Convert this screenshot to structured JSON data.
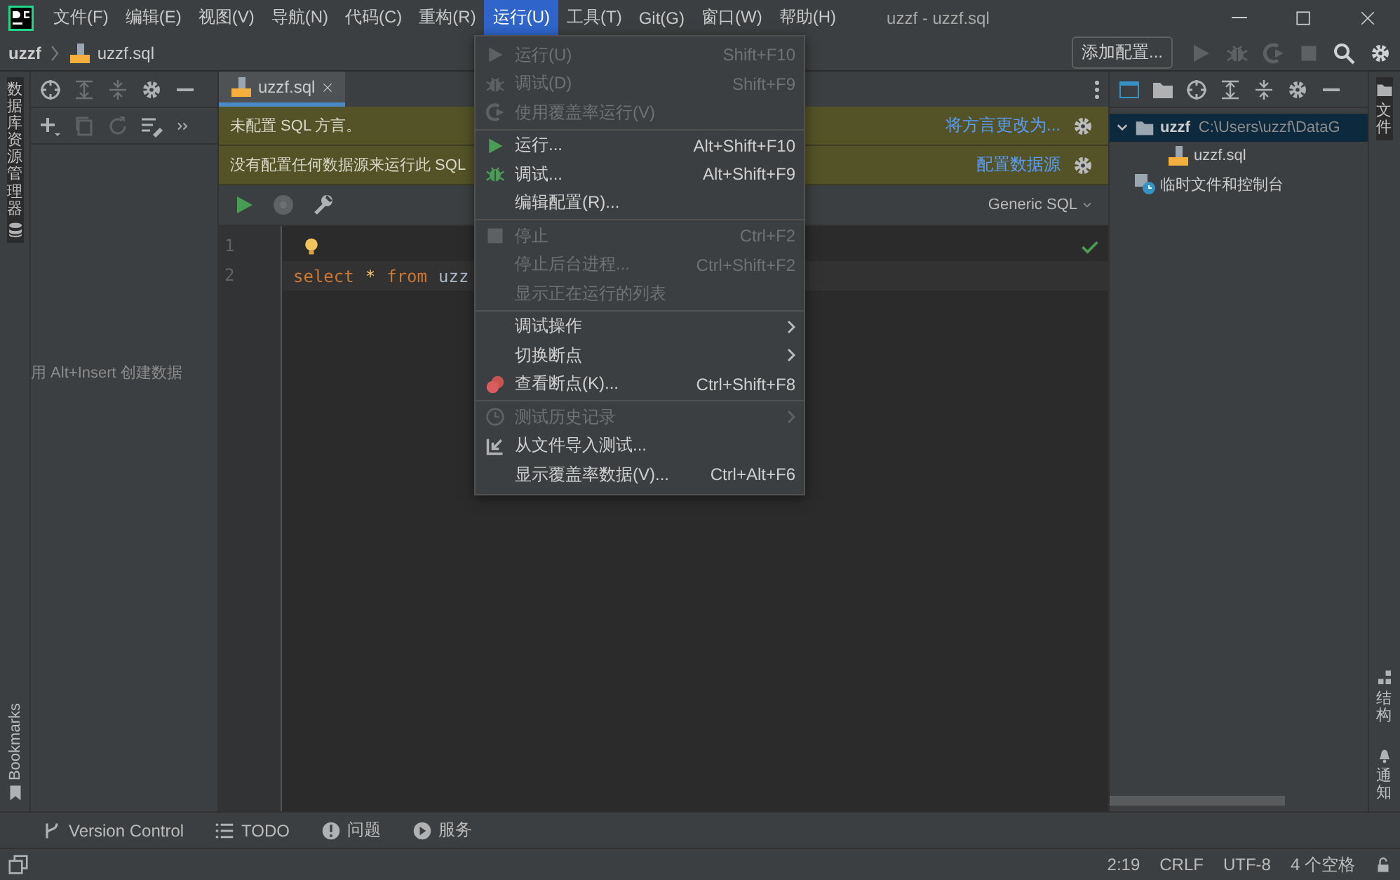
{
  "title_bar": {
    "menus": [
      {
        "label": "文件(F)",
        "selected": false
      },
      {
        "label": "编辑(E)",
        "selected": false
      },
      {
        "label": "视图(V)",
        "selected": false
      },
      {
        "label": "导航(N)",
        "selected": false
      },
      {
        "label": "代码(C)",
        "selected": false
      },
      {
        "label": "重构(R)",
        "selected": false
      },
      {
        "label": "运行(U)",
        "selected": true
      },
      {
        "label": "工具(T)",
        "selected": false
      },
      {
        "label": "Git(G)",
        "selected": false
      },
      {
        "label": "窗口(W)",
        "selected": false
      },
      {
        "label": "帮助(H)",
        "selected": false
      }
    ],
    "title": "uzzf - uzzf.sql"
  },
  "nav_bar": {
    "breadcrumb": [
      "uzzf",
      "uzzf.sql"
    ],
    "config_button": "添加配置..."
  },
  "left_stripe": {
    "top": "数据库资源管理器",
    "bottom": "Bookmarks"
  },
  "db_explorer": {
    "hint": "用 Alt+Insert 创建数据"
  },
  "editor": {
    "tab": {
      "label": "uzzf.sql",
      "selected": true
    },
    "banners": [
      {
        "text": "未配置 SQL 方言。",
        "action": "将方言更改为..."
      },
      {
        "text": "没有配置任何数据源来运行此 SQL",
        "action": "配置数据源"
      }
    ],
    "dialect": "Generic SQL",
    "lines": [
      {
        "number": "1"
      },
      {
        "number": "2",
        "tokens": [
          {
            "kind": "keyword",
            "text": "select"
          },
          {
            "kind": "operator",
            "text": "*"
          },
          {
            "kind": "keyword",
            "text": "from"
          },
          {
            "kind": "identifier",
            "text": "uzz"
          }
        ]
      }
    ]
  },
  "project": {
    "tree": [
      {
        "label": "uzzf",
        "path": "C:\\Users\\uzzf\\DataG",
        "expanded": true,
        "selected": true,
        "children": [
          {
            "label": "uzzf.sql",
            "selected": false
          }
        ]
      },
      {
        "label": "临时文件和控制台",
        "selected": false
      }
    ]
  },
  "right_stripe": {
    "top": "文件",
    "bottom": [
      "结构",
      "通知"
    ]
  },
  "tool_windows": [
    "Version Control",
    "TODO",
    "问题",
    "服务"
  ],
  "status_bar": [
    "2:19",
    "CRLF",
    "UTF-8",
    "4 个空格"
  ],
  "run_menu": {
    "groups": [
      [
        {
          "label": "运行(U)",
          "shortcut": "Shift+F10",
          "disabled": true
        },
        {
          "label": "调试(D)",
          "shortcut": "Shift+F9",
          "disabled": true
        },
        {
          "label": "使用覆盖率运行(V)",
          "disabled": true
        }
      ],
      [
        {
          "label": "运行...",
          "shortcut": "Alt+Shift+F10",
          "disabled": false
        },
        {
          "label": "调试...",
          "shortcut": "Alt+Shift+F9",
          "disabled": false
        },
        {
          "label": "编辑配置(R)...",
          "disabled": false
        }
      ],
      [
        {
          "label": "停止",
          "shortcut": "Ctrl+F2",
          "disabled": true
        },
        {
          "label": "停止后台进程...",
          "shortcut": "Ctrl+Shift+F2",
          "disabled": true
        },
        {
          "label": "显示正在运行的列表",
          "disabled": true
        }
      ],
      [
        {
          "label": "调试操作",
          "disabled": false,
          "submenu": true
        },
        {
          "label": "切换断点",
          "disabled": false,
          "submenu": true
        },
        {
          "label": "查看断点(K)...",
          "shortcut": "Ctrl+Shift+F8",
          "disabled": false
        }
      ],
      [
        {
          "label": "测试历史记录",
          "disabled": true,
          "submenu": true
        },
        {
          "label": "从文件导入测试...",
          "disabled": false
        },
        {
          "label": "显示覆盖率数据(V)...",
          "shortcut": "Ctrl+Alt+F6",
          "disabled": false
        }
      ]
    ]
  }
}
